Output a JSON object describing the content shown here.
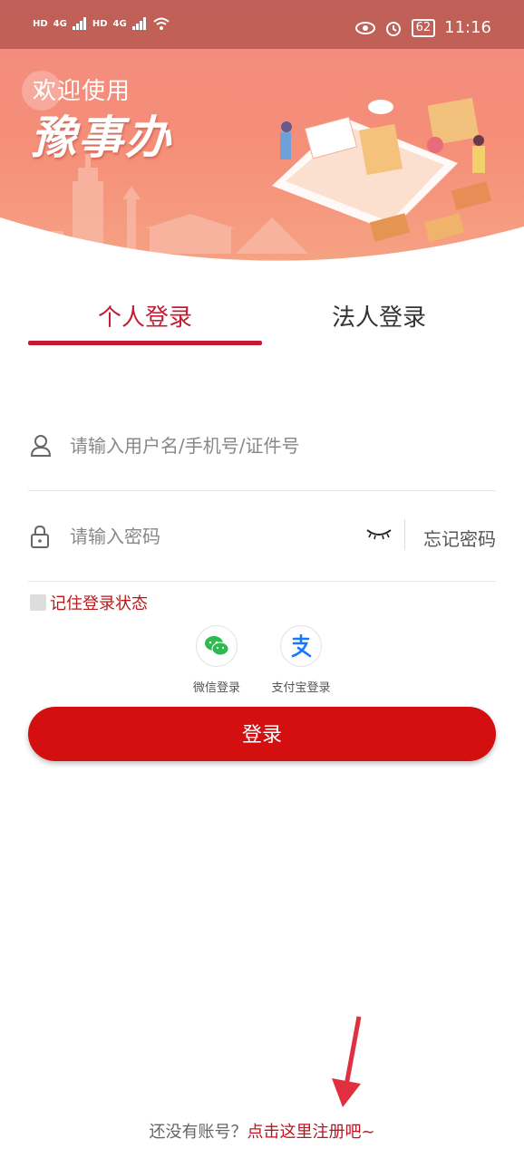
{
  "status_bar": {
    "sim1": "HD",
    "sim2": "HD",
    "net1": "4G",
    "net2": "4G",
    "battery": "62",
    "time": "11:16"
  },
  "hero": {
    "welcome": "欢迎使用",
    "brand": "豫事办"
  },
  "tabs": {
    "personal": "个人登录",
    "legal": "法人登录",
    "active": "personal"
  },
  "form": {
    "username_placeholder": "请输入用户名/手机号/证件号",
    "password_placeholder": "请输入密码",
    "forgot": "忘记密码",
    "remember": "记住登录状态",
    "login_button": "登录"
  },
  "social": {
    "wechat": "微信登录",
    "alipay": "支付宝登录"
  },
  "register": {
    "question": "还没有账号？",
    "link": "点击这里注册吧~"
  },
  "colors": {
    "accent": "#c41b34",
    "button": "#d40f0f",
    "hero": "#f28b7f"
  }
}
